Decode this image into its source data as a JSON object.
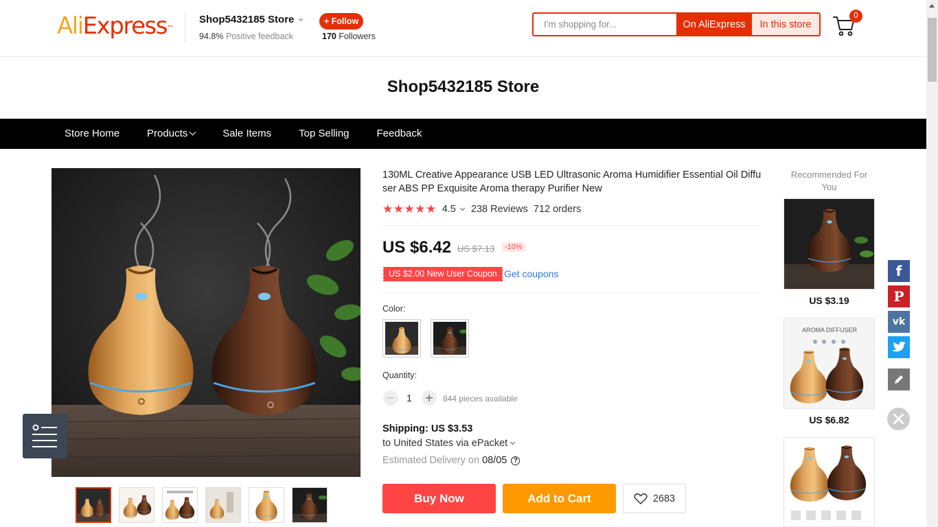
{
  "header": {
    "logo_ali": "Ali",
    "logo_express": "Express",
    "logo_tm": "™",
    "store_name": "Shop5432185 Store",
    "feedback_pct": "94.8%",
    "feedback_label": "Positive feedback",
    "follow_label": "+ Follow",
    "followers_count": "170",
    "followers_label": "Followers",
    "search_placeholder": "I'm shopping for...",
    "search_on_label": "On AliExpress",
    "search_in_label": "In this store",
    "cart_count": "0"
  },
  "store": {
    "title": "Shop5432185 Store",
    "nav": [
      "Store Home",
      "Products",
      "Sale Items",
      "Top Selling",
      "Feedback"
    ]
  },
  "product": {
    "title": "130ML Creative Appearance USB LED Ultrasonic Aroma Humidifier Essential Oil Diffuser ABS PP Exquisite Aroma therapy Purifier New",
    "stars": "★★★★★",
    "rating": "4.5",
    "reviews": "238 Reviews",
    "orders": "712 orders",
    "price": "US $6.42",
    "old_price": "US $7.13",
    "discount": "-10%",
    "coupon": "US $2.00 New User Coupon",
    "get_coupons": "Get coupons",
    "color_label": "Color:",
    "quantity_label": "Quantity:",
    "quantity": "1",
    "minus": "−",
    "plus": "+",
    "available": "844 pieces available",
    "shipping": "Shipping: US $3.53",
    "ship_to": "to United States via ePacket",
    "est_label": "Estimated Delivery on",
    "est_date": "08/05",
    "est_help": "?",
    "buy_now": "Buy Now",
    "add_to_cart": "Add to Cart",
    "wishlist_count": "2683"
  },
  "recommended": {
    "title": "Recommended For You",
    "items": [
      {
        "price": "US $3.19"
      },
      {
        "price": "US $6.82",
        "image_text": "AROMA DIFFUSER"
      },
      {
        "price": ""
      }
    ]
  },
  "social": {
    "facebook_glyph": "f",
    "pinterest_glyph": "P",
    "vk_glyph": "vk"
  },
  "colors": {
    "brand_red": "#e62e04",
    "buy_red": "#ff4444",
    "cart_orange": "#ff9900",
    "facebook": "#3b5998",
    "pinterest": "#cb2027",
    "vk": "#4c75a3",
    "twitter": "#1da1f2"
  }
}
